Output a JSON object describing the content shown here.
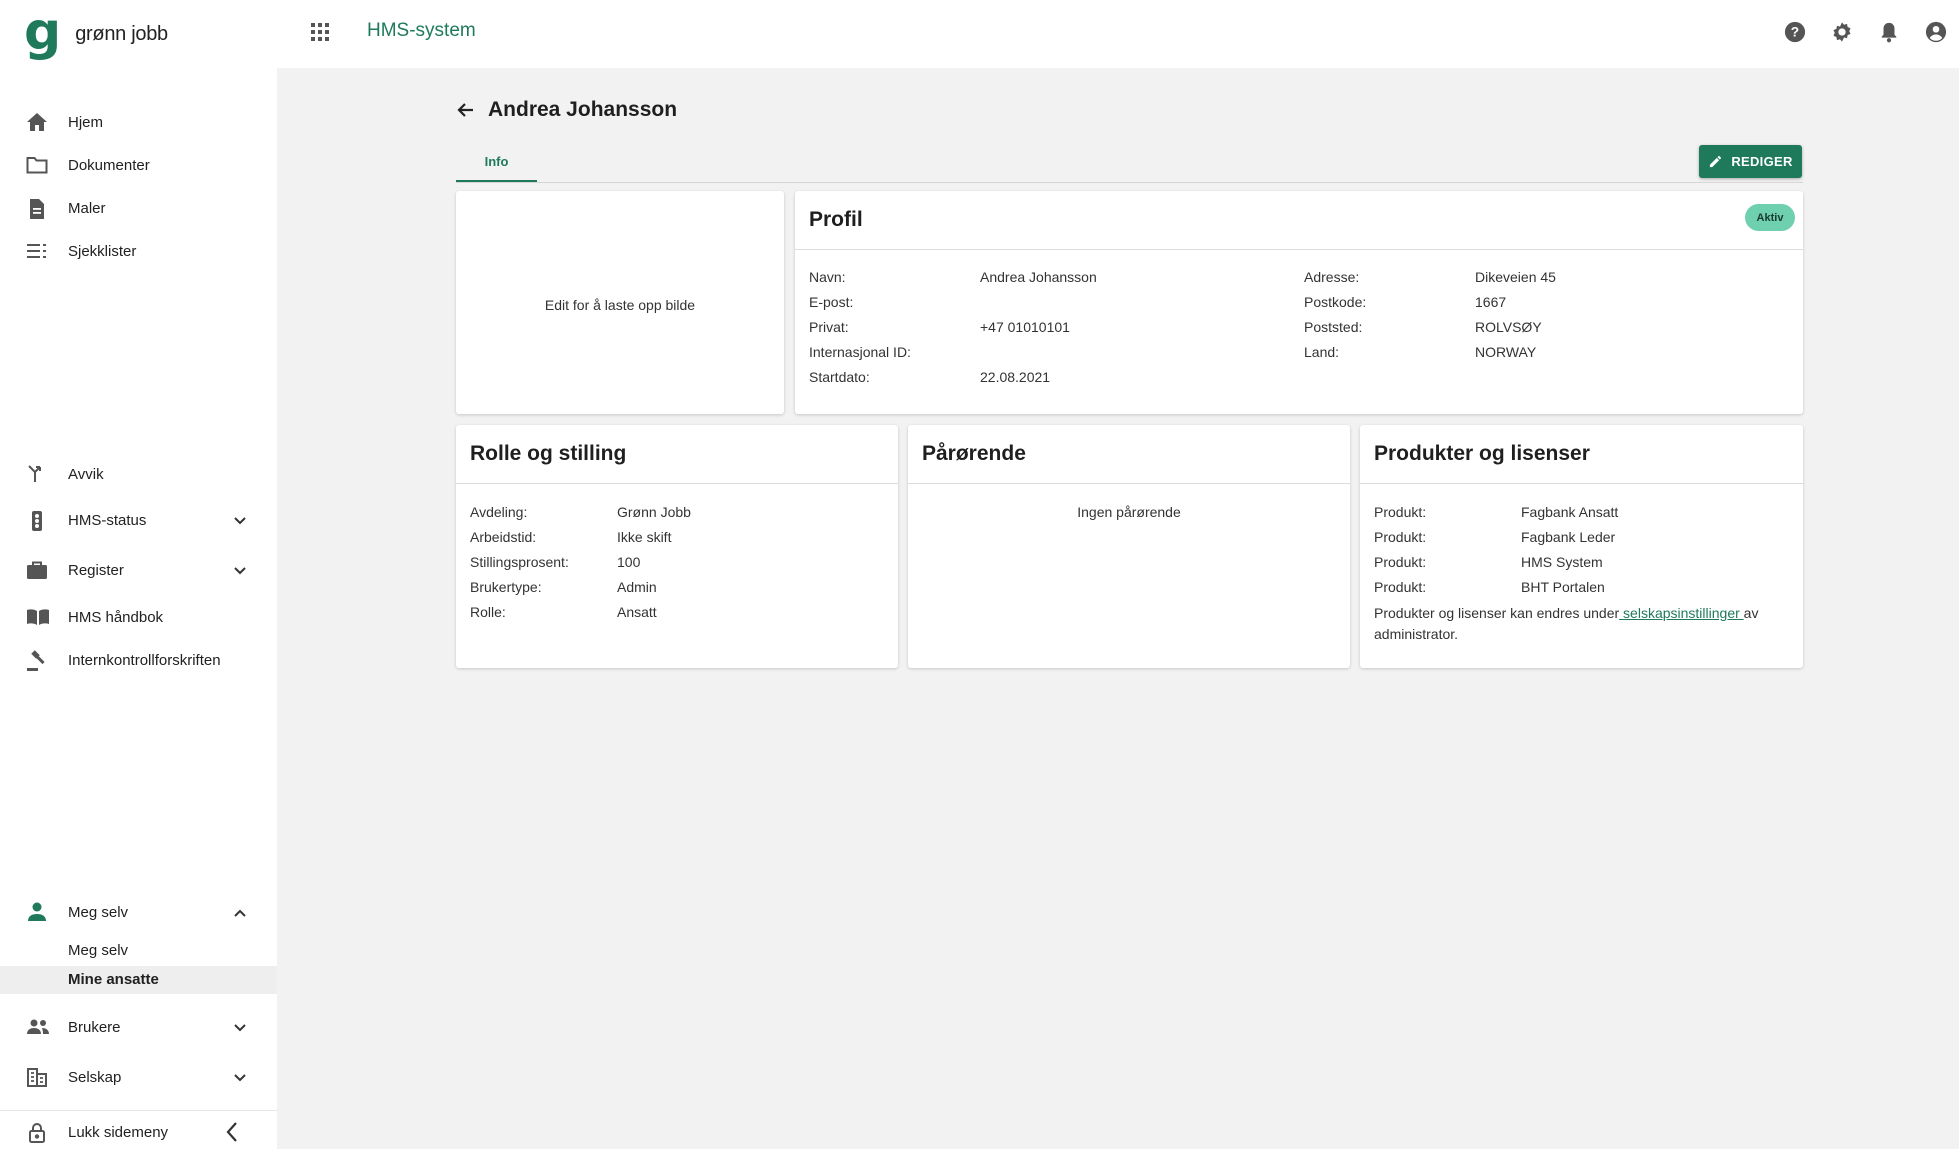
{
  "brand": {
    "logo_mark": "g",
    "logo_text": "grønn jobb",
    "accent": "#1e7a5a"
  },
  "topbar": {
    "app_title": "HMS-system",
    "icons": [
      "apps-grid-icon",
      "help-icon",
      "settings-icon",
      "notifications-icon",
      "account-icon"
    ]
  },
  "sidebar": {
    "items": [
      {
        "label": "Hjem",
        "icon": "home-icon"
      },
      {
        "label": "Dokumenter",
        "icon": "folder-icon"
      },
      {
        "label": "Maler",
        "icon": "document-icon"
      },
      {
        "label": "Sjekklister",
        "icon": "checklist-icon"
      },
      {
        "label": "Avvik",
        "icon": "deviation-icon"
      },
      {
        "label": "HMS-status",
        "icon": "traffic-light-icon"
      },
      {
        "label": "Register",
        "icon": "briefcase-icon"
      },
      {
        "label": "HMS håndbok",
        "icon": "book-icon"
      },
      {
        "label": "Internkontrollforskriften",
        "icon": "gavel-icon"
      },
      {
        "label": "Meg selv",
        "icon": "person-icon"
      },
      {
        "label": "Brukere",
        "icon": "people-icon"
      },
      {
        "label": "Selskap",
        "icon": "building-icon"
      },
      {
        "label": "Lukk sidemeny",
        "icon": "lock-icon"
      }
    ],
    "sub_items": [
      {
        "label": "Meg selv"
      },
      {
        "label": "Mine ansatte"
      }
    ]
  },
  "page": {
    "title": "Andrea Johansson",
    "tab_info": "Info",
    "edit_label": "REDIGER"
  },
  "image_card": {
    "text": "Edit for å laste opp bilde"
  },
  "profile": {
    "title": "Profil",
    "status": "Aktiv",
    "left": [
      {
        "label": "Navn:",
        "value": "Andrea Johansson"
      },
      {
        "label": "E-post:",
        "value": ""
      },
      {
        "label": "Privat:",
        "value": "+47 01010101"
      },
      {
        "label": "Internasjonal ID:",
        "value": ""
      },
      {
        "label": "Startdato:",
        "value": "22.08.2021"
      }
    ],
    "right": [
      {
        "label": "Adresse:",
        "value": "Dikeveien 45"
      },
      {
        "label": "Postkode:",
        "value": "1667"
      },
      {
        "label": "Poststed:",
        "value": "ROLVSØY"
      },
      {
        "label": "Land:",
        "value": "NORWAY"
      }
    ]
  },
  "role": {
    "title": "Rolle og stilling",
    "rows": [
      {
        "label": "Avdeling:",
        "value": "Grønn Jobb"
      },
      {
        "label": "Arbeidstid:",
        "value": "Ikke skift"
      },
      {
        "label": "Stillingsprosent:",
        "value": "100"
      },
      {
        "label": "Brukertype:",
        "value": "Admin"
      },
      {
        "label": "Rolle:",
        "value": "Ansatt"
      }
    ]
  },
  "relatives": {
    "title": "Pårørende",
    "empty": "Ingen pårørende"
  },
  "products": {
    "title": "Produkter og lisenser",
    "rows": [
      {
        "label": "Produkt:",
        "value": "Fagbank Ansatt"
      },
      {
        "label": "Produkt:",
        "value": "Fagbank Leder"
      },
      {
        "label": "Produkt:",
        "value": "HMS System"
      },
      {
        "label": "Produkt:",
        "value": "BHT Portalen"
      }
    ],
    "note_before": "Produkter og lisenser kan endres under",
    "note_link": " selskapsinstillinger ",
    "note_after": "av administrator."
  }
}
